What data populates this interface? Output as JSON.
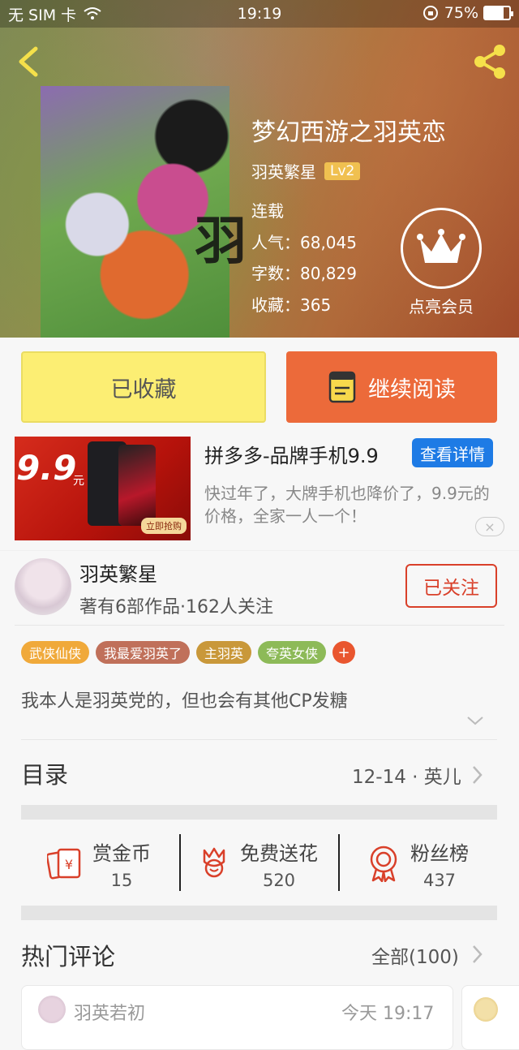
{
  "status_bar": {
    "carrier": "无 SIM 卡",
    "time": "19:19",
    "battery": "75%",
    "battery_level": 0.75
  },
  "book": {
    "title": "梦幻西游之羽英恋",
    "cover_glyph": "羽",
    "author": "羽英繁星",
    "level": "Lv2",
    "status": "连载",
    "popularity": "人气：68,045",
    "word_count": "字数：80,829",
    "favorites": "收藏：365"
  },
  "member": {
    "label": "点亮会员",
    "icon": "crown-icon"
  },
  "actions": {
    "collected_label": "已收藏",
    "continue_label": "继续阅读"
  },
  "ad": {
    "price": "9.9",
    "price_unit": "元",
    "buy_label": "立即抢购",
    "title": "拼多多-品牌手机9.9",
    "detail_label": "查看详情",
    "description": "快过年了，大牌手机也降价了，9.9元的价格，全家一人一个！",
    "close_symbol": "×"
  },
  "author_info": {
    "name": "羽英繁星",
    "meta": "著有6部作品·162人关注",
    "follow_label": "已关注"
  },
  "tags": [
    {
      "label": "武侠仙侠",
      "color": "#f0a93a"
    },
    {
      "label": "我最爱羽英了",
      "color": "#c0705a"
    },
    {
      "label": "主羽英",
      "color": "#c9983a"
    },
    {
      "label": "夸英女侠",
      "color": "#8dba58"
    }
  ],
  "tag_add": "+",
  "intro": "我本人是羽英党的，但也会有其他CP发糖",
  "catalog": {
    "label": "目录",
    "latest": "12-14 · 英儿"
  },
  "stats": [
    {
      "label": "赏金币",
      "value": "15",
      "icon": "red-envelope-icon"
    },
    {
      "label": "免费送花",
      "value": "520",
      "icon": "flower-icon"
    },
    {
      "label": "粉丝榜",
      "value": "437",
      "icon": "medal-icon"
    }
  ],
  "hot_comments": {
    "label": "热门评论",
    "all_label": "全部(100)",
    "first": {
      "user": "羽英若初",
      "time": "今天 19:17"
    }
  },
  "colors": {
    "accent_orange": "#ec6a3a",
    "collect_yellow": "#fcee73",
    "follow_red": "#d9402a",
    "ad_blue": "#1e7be5"
  }
}
